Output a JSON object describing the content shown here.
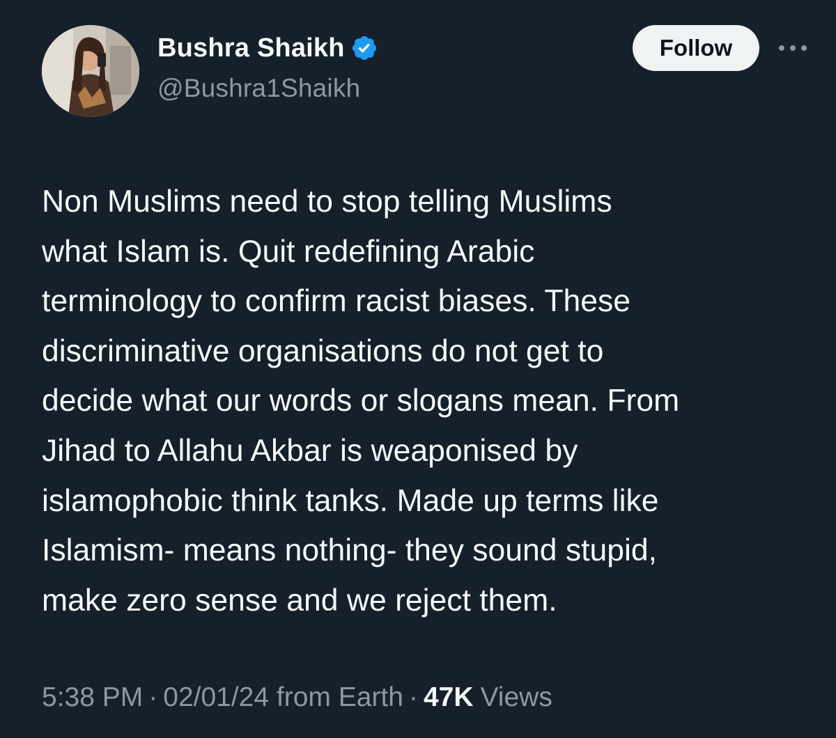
{
  "author": {
    "display_name": "Bushra Shaikh",
    "handle": "@Bushra1Shaikh",
    "verified": true,
    "verified_color": "#1d9bf0",
    "avatar_icon": "profile-photo"
  },
  "actions": {
    "follow_label": "Follow",
    "more_icon": "ellipsis-icon"
  },
  "tweet": {
    "text": "Non Muslims need to stop telling Muslims\nwhat Islam is. Quit redefining Arabic\nterminology to confirm racist biases. These\ndiscriminative organisations do not get to\ndecide what our words or slogans mean. From\nJihad to Allahu Akbar is weaponised by\nislamophobic think tanks. Made up terms like\nIslamism- means nothing- they sound stupid,\nmake zero sense and we reject them."
  },
  "meta": {
    "time": "5:38 PM",
    "separator": "·",
    "date_source": "02/01/24 from Earth",
    "views_count": "47K",
    "views_label": "Views"
  },
  "colors": {
    "background": "#15202b",
    "text_primary": "#f7f9f9",
    "text_secondary": "#8b98a5",
    "button_bg": "#eff3f4"
  }
}
